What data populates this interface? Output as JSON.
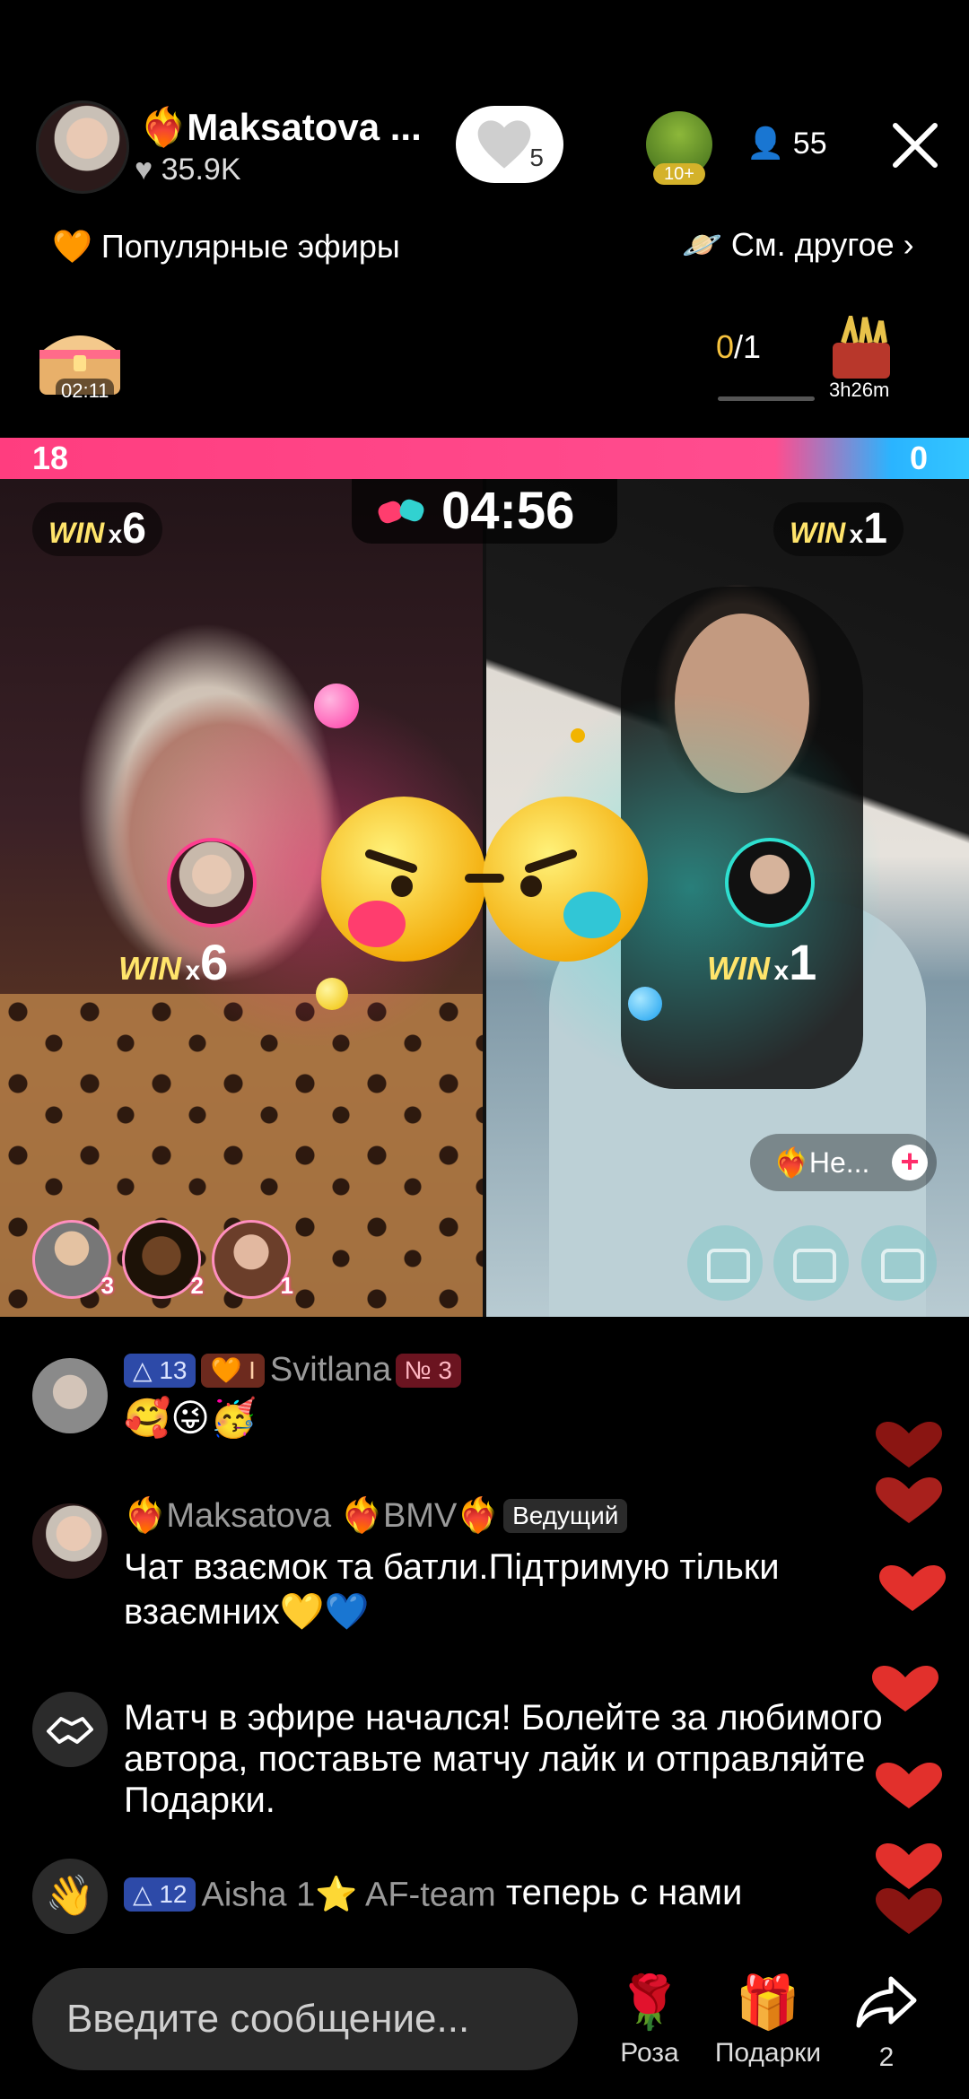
{
  "header": {
    "host_name": "Maksatova ...",
    "host_likes": "35.9K",
    "like_count": "5",
    "top_gifter_badge": "10+",
    "viewers": "55",
    "popular_label": "Популярные эфиры",
    "see_other_label": "См. другое",
    "chest_timer": "02:11",
    "progress_current": "0",
    "progress_total": "/1",
    "prize_timer": "3h26m"
  },
  "battle": {
    "score_left": "18",
    "score_right": "0",
    "timer": "04:56",
    "win_word": "WIN",
    "x_word": "x",
    "left_wins": "6",
    "right_wins": "1",
    "left_rank_1": "3",
    "left_rank_2": "2",
    "left_rank_3": "1",
    "guest_label": "Не...",
    "colors": {
      "left": "#ff3d8f",
      "right": "#2ee0d0"
    }
  },
  "chat": {
    "m1": {
      "level": "13",
      "fan": "I",
      "user": "Svitlana",
      "no": "№ 3",
      "text": "🥰😜🥳"
    },
    "m2": {
      "user": "Maksatova ❤️‍🔥BMV❤️‍🔥",
      "host_tag": "Ведущий",
      "text": "Чат взаємок та батли.Підтримую тільки взаємних💛💙"
    },
    "m3": {
      "text": "Матч в эфире начался! Болейте за любимого автора, поставьте матчу лайк и отправляйте Подарки."
    },
    "m4": {
      "level": "12",
      "user": "Aisha 1⭐ AF-team",
      "text": "теперь с нами"
    }
  },
  "bottom": {
    "input_placeholder": "Введите сообщение...",
    "rose_label": "Роза",
    "gifts_label": "Подарки",
    "share_count": "2"
  }
}
